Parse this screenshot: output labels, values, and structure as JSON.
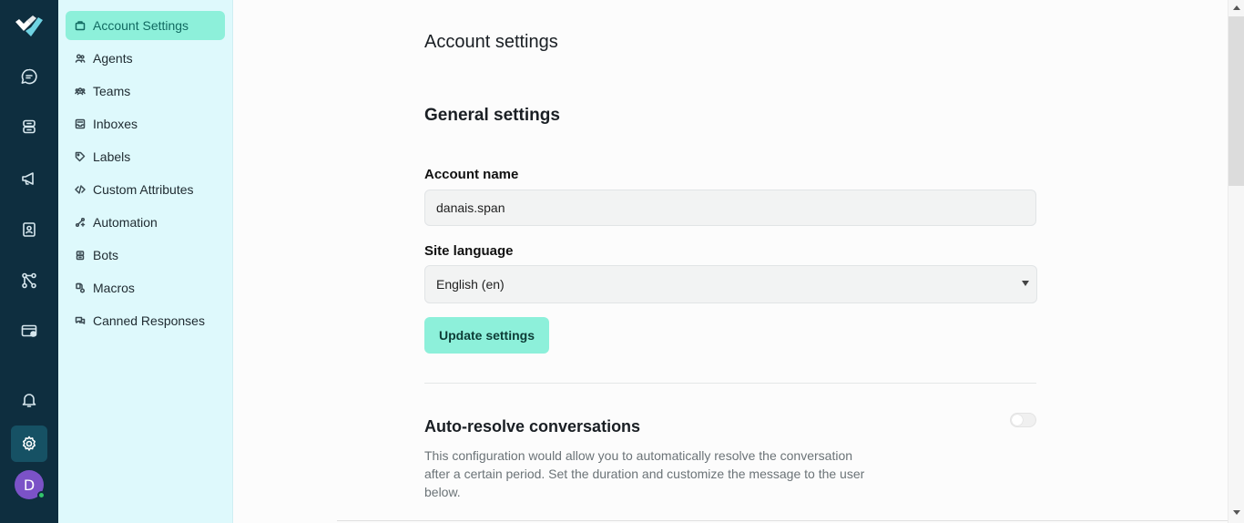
{
  "rail": {
    "items": [
      {
        "name": "logo",
        "icon": "brand-logo"
      },
      {
        "name": "conversations",
        "icon": "chat-bubble-icon"
      },
      {
        "name": "captain",
        "icon": "inbox-stack-icon"
      },
      {
        "name": "campaigns",
        "icon": "megaphone-icon"
      },
      {
        "name": "contacts",
        "icon": "contact-card-icon"
      },
      {
        "name": "integrations",
        "icon": "flow-nodes-icon"
      },
      {
        "name": "billing",
        "icon": "wallet-icon"
      },
      {
        "name": "notifications",
        "icon": "bell-icon"
      },
      {
        "name": "settings",
        "icon": "gear-icon"
      }
    ],
    "avatar_initial": "D",
    "colors": {
      "background": "#0e2e3f",
      "active": "#165164",
      "avatar": "#7b52c7",
      "online": "#33c46b"
    }
  },
  "sidebar": {
    "items": [
      {
        "label": "Account Settings",
        "icon": "briefcase-icon",
        "active": true
      },
      {
        "label": "Agents",
        "icon": "users-icon"
      },
      {
        "label": "Teams",
        "icon": "team-icon"
      },
      {
        "label": "Inboxes",
        "icon": "inbox-icon"
      },
      {
        "label": "Labels",
        "icon": "tag-icon"
      },
      {
        "label": "Custom Attributes",
        "icon": "code-icon"
      },
      {
        "label": "Automation",
        "icon": "automation-icon"
      },
      {
        "label": "Bots",
        "icon": "bot-icon"
      },
      {
        "label": "Macros",
        "icon": "macro-icon"
      },
      {
        "label": "Canned Responses",
        "icon": "chat-responses-icon"
      }
    ],
    "colors": {
      "background": "#def9fc",
      "active": "#8df0da"
    }
  },
  "main": {
    "page_title": "Account settings",
    "general_title": "General settings",
    "account_name_label": "Account name",
    "account_name_value": "danais.span",
    "site_language_label": "Site language",
    "site_language_value": "English (en)",
    "update_button": "Update settings",
    "auto_resolve_title": "Auto-resolve conversations",
    "auto_resolve_enabled": false,
    "auto_resolve_description": "This configuration would allow you to automatically resolve the conversation after a certain period. Set the duration and customize the message to the user below."
  }
}
